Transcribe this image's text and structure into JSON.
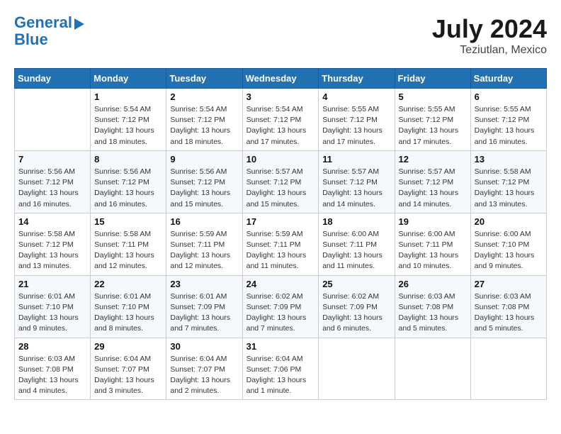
{
  "logo": {
    "line1": "General",
    "line2": "Blue"
  },
  "title": {
    "month_year": "July 2024",
    "location": "Teziutlan, Mexico"
  },
  "weekdays": [
    "Sunday",
    "Monday",
    "Tuesday",
    "Wednesday",
    "Thursday",
    "Friday",
    "Saturday"
  ],
  "weeks": [
    [
      {
        "day": "",
        "info": ""
      },
      {
        "day": "1",
        "info": "Sunrise: 5:54 AM\nSunset: 7:12 PM\nDaylight: 13 hours\nand 18 minutes."
      },
      {
        "day": "2",
        "info": "Sunrise: 5:54 AM\nSunset: 7:12 PM\nDaylight: 13 hours\nand 18 minutes."
      },
      {
        "day": "3",
        "info": "Sunrise: 5:54 AM\nSunset: 7:12 PM\nDaylight: 13 hours\nand 17 minutes."
      },
      {
        "day": "4",
        "info": "Sunrise: 5:55 AM\nSunset: 7:12 PM\nDaylight: 13 hours\nand 17 minutes."
      },
      {
        "day": "5",
        "info": "Sunrise: 5:55 AM\nSunset: 7:12 PM\nDaylight: 13 hours\nand 17 minutes."
      },
      {
        "day": "6",
        "info": "Sunrise: 5:55 AM\nSunset: 7:12 PM\nDaylight: 13 hours\nand 16 minutes."
      }
    ],
    [
      {
        "day": "7",
        "info": "Sunrise: 5:56 AM\nSunset: 7:12 PM\nDaylight: 13 hours\nand 16 minutes."
      },
      {
        "day": "8",
        "info": "Sunrise: 5:56 AM\nSunset: 7:12 PM\nDaylight: 13 hours\nand 16 minutes."
      },
      {
        "day": "9",
        "info": "Sunrise: 5:56 AM\nSunset: 7:12 PM\nDaylight: 13 hours\nand 15 minutes."
      },
      {
        "day": "10",
        "info": "Sunrise: 5:57 AM\nSunset: 7:12 PM\nDaylight: 13 hours\nand 15 minutes."
      },
      {
        "day": "11",
        "info": "Sunrise: 5:57 AM\nSunset: 7:12 PM\nDaylight: 13 hours\nand 14 minutes."
      },
      {
        "day": "12",
        "info": "Sunrise: 5:57 AM\nSunset: 7:12 PM\nDaylight: 13 hours\nand 14 minutes."
      },
      {
        "day": "13",
        "info": "Sunrise: 5:58 AM\nSunset: 7:12 PM\nDaylight: 13 hours\nand 13 minutes."
      }
    ],
    [
      {
        "day": "14",
        "info": "Sunrise: 5:58 AM\nSunset: 7:12 PM\nDaylight: 13 hours\nand 13 minutes."
      },
      {
        "day": "15",
        "info": "Sunrise: 5:58 AM\nSunset: 7:11 PM\nDaylight: 13 hours\nand 12 minutes."
      },
      {
        "day": "16",
        "info": "Sunrise: 5:59 AM\nSunset: 7:11 PM\nDaylight: 13 hours\nand 12 minutes."
      },
      {
        "day": "17",
        "info": "Sunrise: 5:59 AM\nSunset: 7:11 PM\nDaylight: 13 hours\nand 11 minutes."
      },
      {
        "day": "18",
        "info": "Sunrise: 6:00 AM\nSunset: 7:11 PM\nDaylight: 13 hours\nand 11 minutes."
      },
      {
        "day": "19",
        "info": "Sunrise: 6:00 AM\nSunset: 7:11 PM\nDaylight: 13 hours\nand 10 minutes."
      },
      {
        "day": "20",
        "info": "Sunrise: 6:00 AM\nSunset: 7:10 PM\nDaylight: 13 hours\nand 9 minutes."
      }
    ],
    [
      {
        "day": "21",
        "info": "Sunrise: 6:01 AM\nSunset: 7:10 PM\nDaylight: 13 hours\nand 9 minutes."
      },
      {
        "day": "22",
        "info": "Sunrise: 6:01 AM\nSunset: 7:10 PM\nDaylight: 13 hours\nand 8 minutes."
      },
      {
        "day": "23",
        "info": "Sunrise: 6:01 AM\nSunset: 7:09 PM\nDaylight: 13 hours\nand 7 minutes."
      },
      {
        "day": "24",
        "info": "Sunrise: 6:02 AM\nSunset: 7:09 PM\nDaylight: 13 hours\nand 7 minutes."
      },
      {
        "day": "25",
        "info": "Sunrise: 6:02 AM\nSunset: 7:09 PM\nDaylight: 13 hours\nand 6 minutes."
      },
      {
        "day": "26",
        "info": "Sunrise: 6:03 AM\nSunset: 7:08 PM\nDaylight: 13 hours\nand 5 minutes."
      },
      {
        "day": "27",
        "info": "Sunrise: 6:03 AM\nSunset: 7:08 PM\nDaylight: 13 hours\nand 5 minutes."
      }
    ],
    [
      {
        "day": "28",
        "info": "Sunrise: 6:03 AM\nSunset: 7:08 PM\nDaylight: 13 hours\nand 4 minutes."
      },
      {
        "day": "29",
        "info": "Sunrise: 6:04 AM\nSunset: 7:07 PM\nDaylight: 13 hours\nand 3 minutes."
      },
      {
        "day": "30",
        "info": "Sunrise: 6:04 AM\nSunset: 7:07 PM\nDaylight: 13 hours\nand 2 minutes."
      },
      {
        "day": "31",
        "info": "Sunrise: 6:04 AM\nSunset: 7:06 PM\nDaylight: 13 hours\nand 1 minute."
      },
      {
        "day": "",
        "info": ""
      },
      {
        "day": "",
        "info": ""
      },
      {
        "day": "",
        "info": ""
      }
    ]
  ]
}
